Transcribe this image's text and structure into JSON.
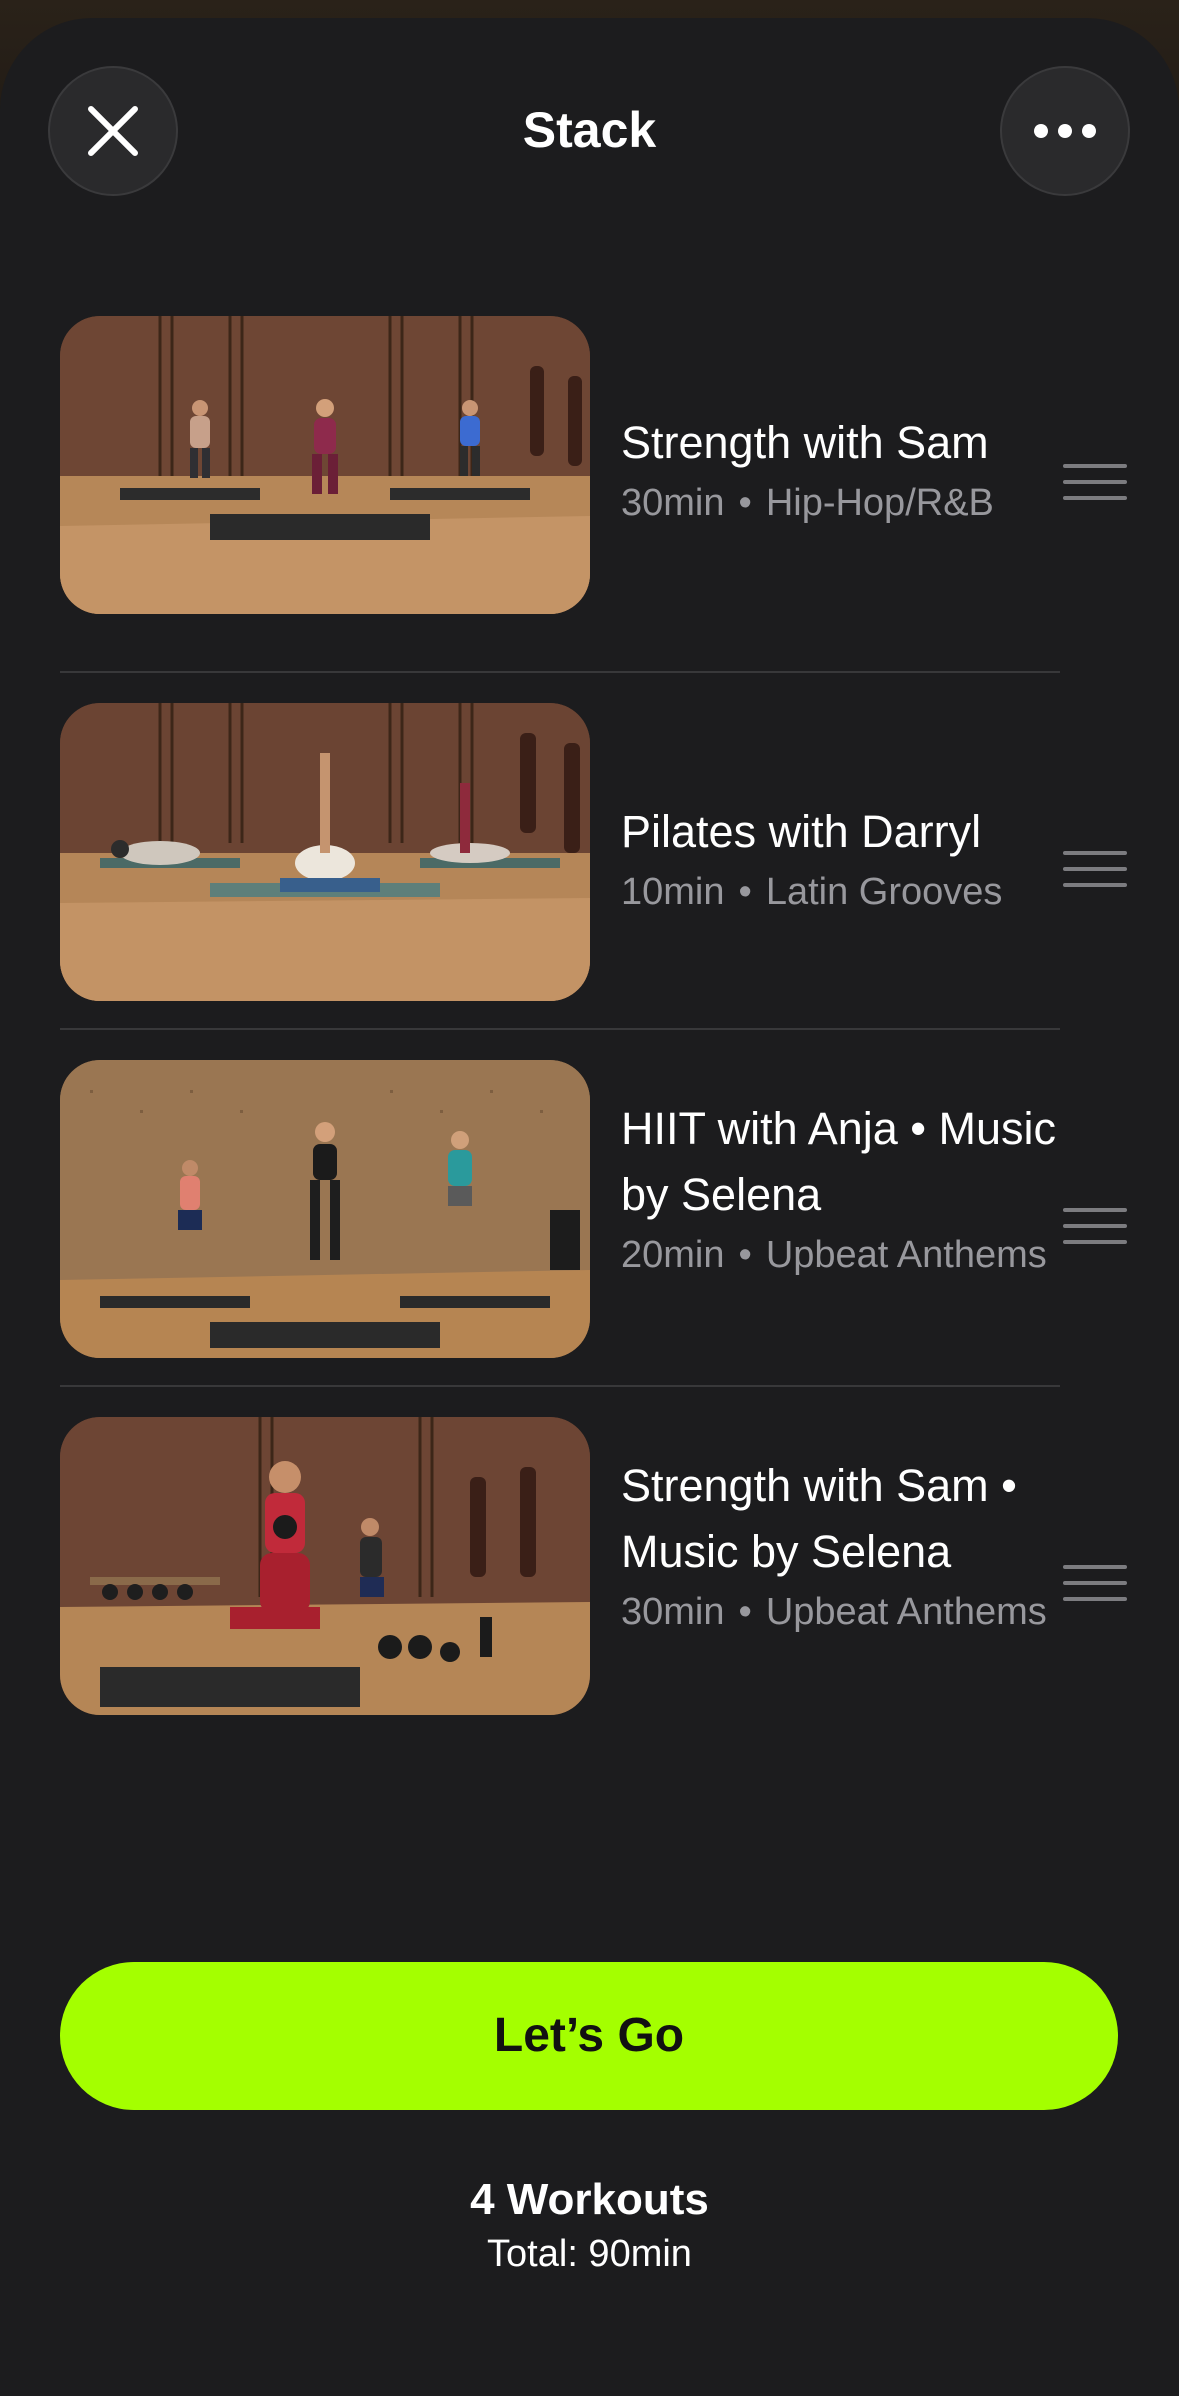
{
  "header": {
    "title": "Stack",
    "close_icon": "close-icon",
    "more_icon": "more-horizontal-icon"
  },
  "workouts": [
    {
      "title": "Strength with Sam",
      "duration": "30min",
      "music": "Hip-Hop/R&B",
      "thumbnail": "Three trainers doing lunges in a brick-walled studio"
    },
    {
      "title": "Pilates with Darryl",
      "duration": "10min",
      "music": "Latin Grooves",
      "thumbnail": "Three trainers doing floor leg raises in a studio"
    },
    {
      "title": "HIIT with Anja • Music by Selena",
      "duration": "20min",
      "music": "Upbeat Anthems",
      "thumbnail": "Three trainers doing cross-body kicks in a wood-paneled studio"
    },
    {
      "title": "Strength with Sam • Music by Selena",
      "duration": "30min",
      "music": "Upbeat Anthems",
      "thumbnail": "Trainer kneeling with a kettlebell in a brick-walled studio"
    }
  ],
  "footer": {
    "cta_label": "Let’s Go",
    "workout_count": "4 Workouts",
    "total": "Total: 90min"
  },
  "colors": {
    "accent": "#a4ff00",
    "sheet_background": "#1c1c1e",
    "secondary_text": "#98989d"
  }
}
